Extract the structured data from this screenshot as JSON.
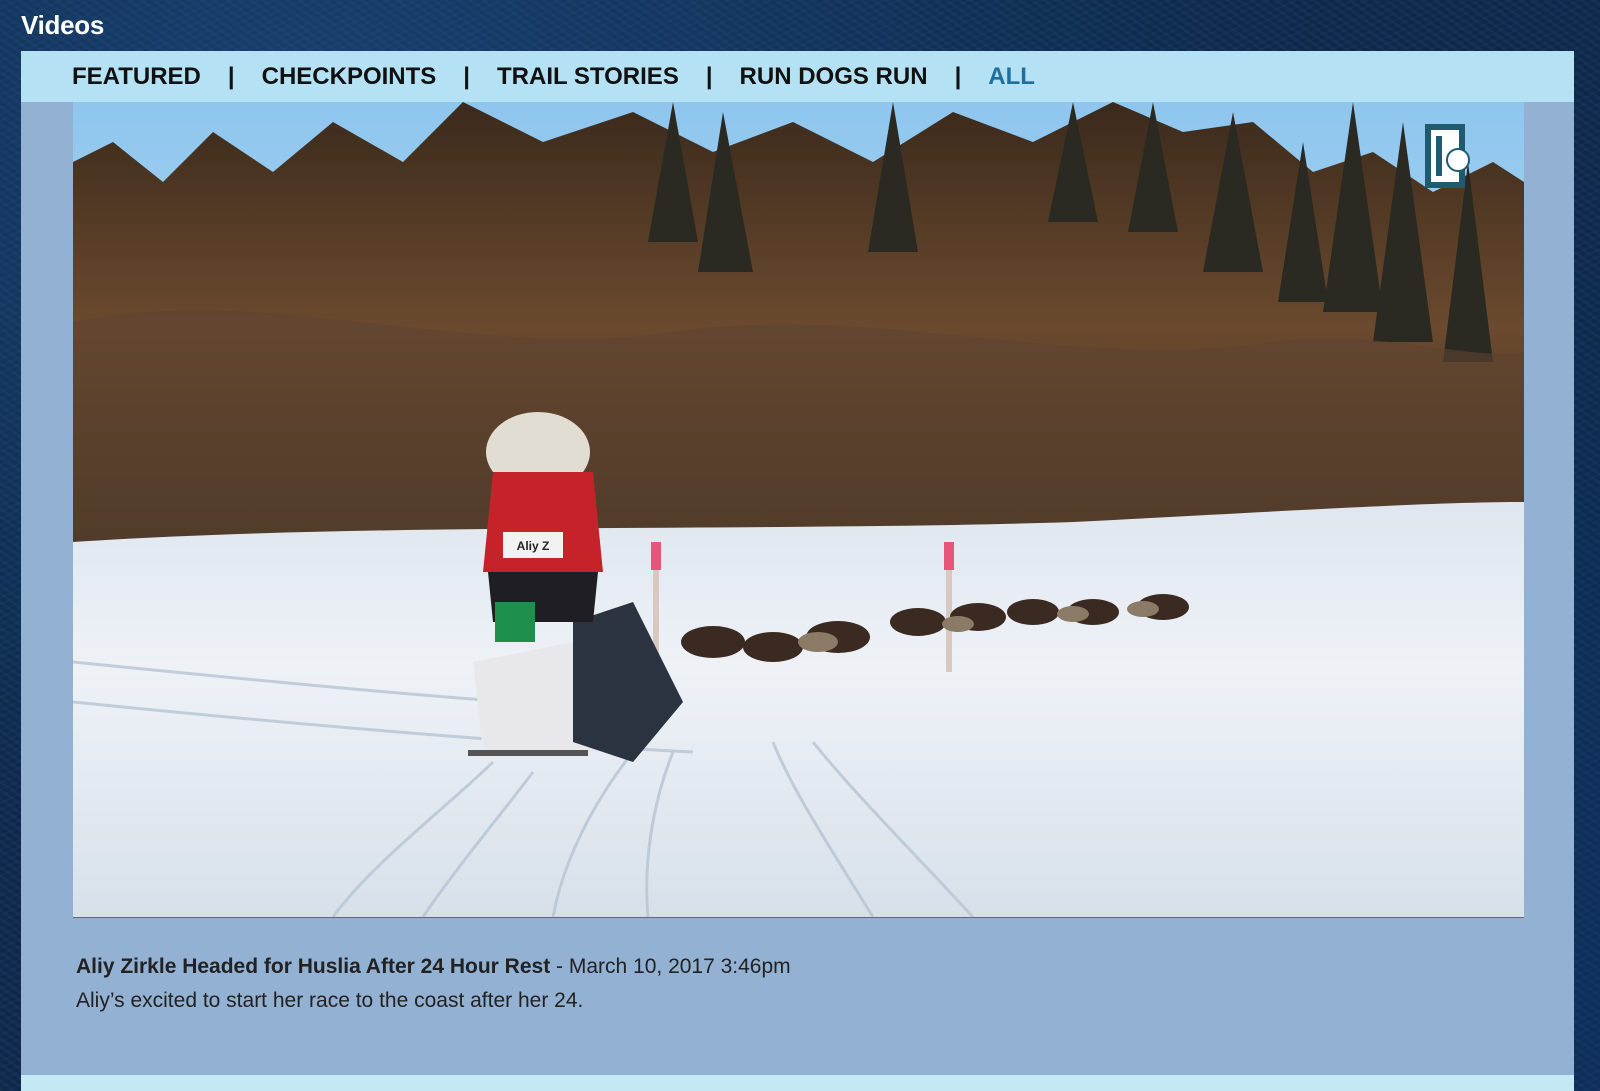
{
  "section": {
    "title": "Videos"
  },
  "nav": {
    "tabs": [
      {
        "label": "FEATURED",
        "active": false
      },
      {
        "label": "CHECKPOINTS",
        "active": false
      },
      {
        "label": "TRAIL STORIES",
        "active": false
      },
      {
        "label": "RUN DOGS RUN",
        "active": false
      },
      {
        "label": "ALL",
        "active": true
      }
    ],
    "separator": "|",
    "active_color": "#1d6f9c"
  },
  "video": {
    "logo_icon": "iditarod-logo-icon",
    "bib_text": "Aliy Z"
  },
  "caption": {
    "title": "Aliy Zirkle Headed for Huslia After 24 Hour Rest",
    "dash": " - ",
    "date": "March 10, 2017 3:46pm",
    "description": "Aliy’s excited to start her race to the coast after her 24."
  },
  "colors": {
    "background": "#0c2a4f",
    "panel": "#93b1d2",
    "tabbar": "#b4e1f3"
  }
}
